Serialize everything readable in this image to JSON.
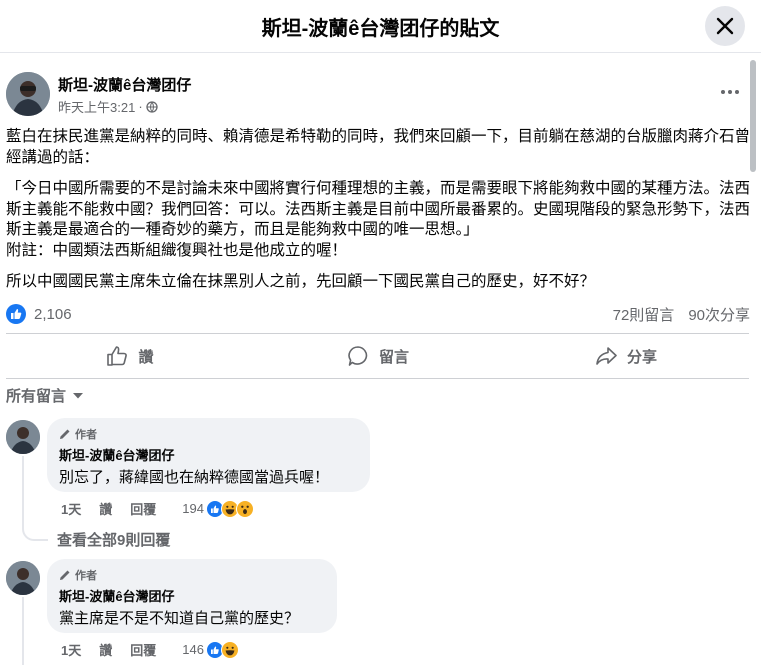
{
  "header": {
    "title": "斯坦-波蘭ê台灣团仔的貼文"
  },
  "post": {
    "author": "斯坦-波蘭ê台灣团仔",
    "timestamp": "昨天上午3:21",
    "separator": "·",
    "paragraphs": [
      "藍白在抹民進黨是納粹的同時、賴清德是希特勒的同時，我們來回顧一下，目前躺在慈湖的台版臘肉蔣介石曾經講過的話：",
      "「今日中國所需要的不是討論未來中國將實行何種理想的主義，而是需要眼下將能夠救中國的某種方法。法西斯主義能不能救中國？我們回答：可以。法西斯主義是目前中國所最番累的。史國現階段的緊急形勢下，法西斯主義是最適合的一種奇妙的藥方，而且是能夠救中國的唯一思想。」",
      "附註：中國類法西斯組織復興社也是他成立的喔！",
      "所以中國國民黨主席朱立倫在抹黑別人之前，先回顧一下國民黨自己的歷史，好不好？"
    ],
    "like_count": "2,106",
    "comments_count": "72則留言",
    "shares_count": "90次分享"
  },
  "actions": {
    "like": "讚",
    "comment": "留言",
    "share": "分享"
  },
  "comments_filter": "所有留言",
  "comments": [
    {
      "badge": "作者",
      "name": "斯坦-波蘭ê台灣团仔",
      "text": "別忘了，蔣緯國也在納粹德國當過兵喔！",
      "time": "1天",
      "like": "讚",
      "reply": "回覆",
      "reactions": "194"
    },
    {
      "badge": "作者",
      "name": "斯坦-波蘭ê台灣团仔",
      "text": "黨主席是不是不知道自己黨的歷史？",
      "time": "1天",
      "like": "讚",
      "reply": "回覆",
      "reactions": "146"
    }
  ],
  "view_replies": "查看全部9則回覆",
  "colors": {
    "like_blue": "#1877f2",
    "haha_yellow": "#f7b125",
    "secondary_text": "#65676b",
    "bubble_bg": "#f0f2f5"
  },
  "icons": [
    "close-icon",
    "globe-icon",
    "more-icon",
    "like-icon",
    "comment-icon",
    "share-icon",
    "chevron-down-icon",
    "pen-icon",
    "haha-icon",
    "wow-icon"
  ]
}
